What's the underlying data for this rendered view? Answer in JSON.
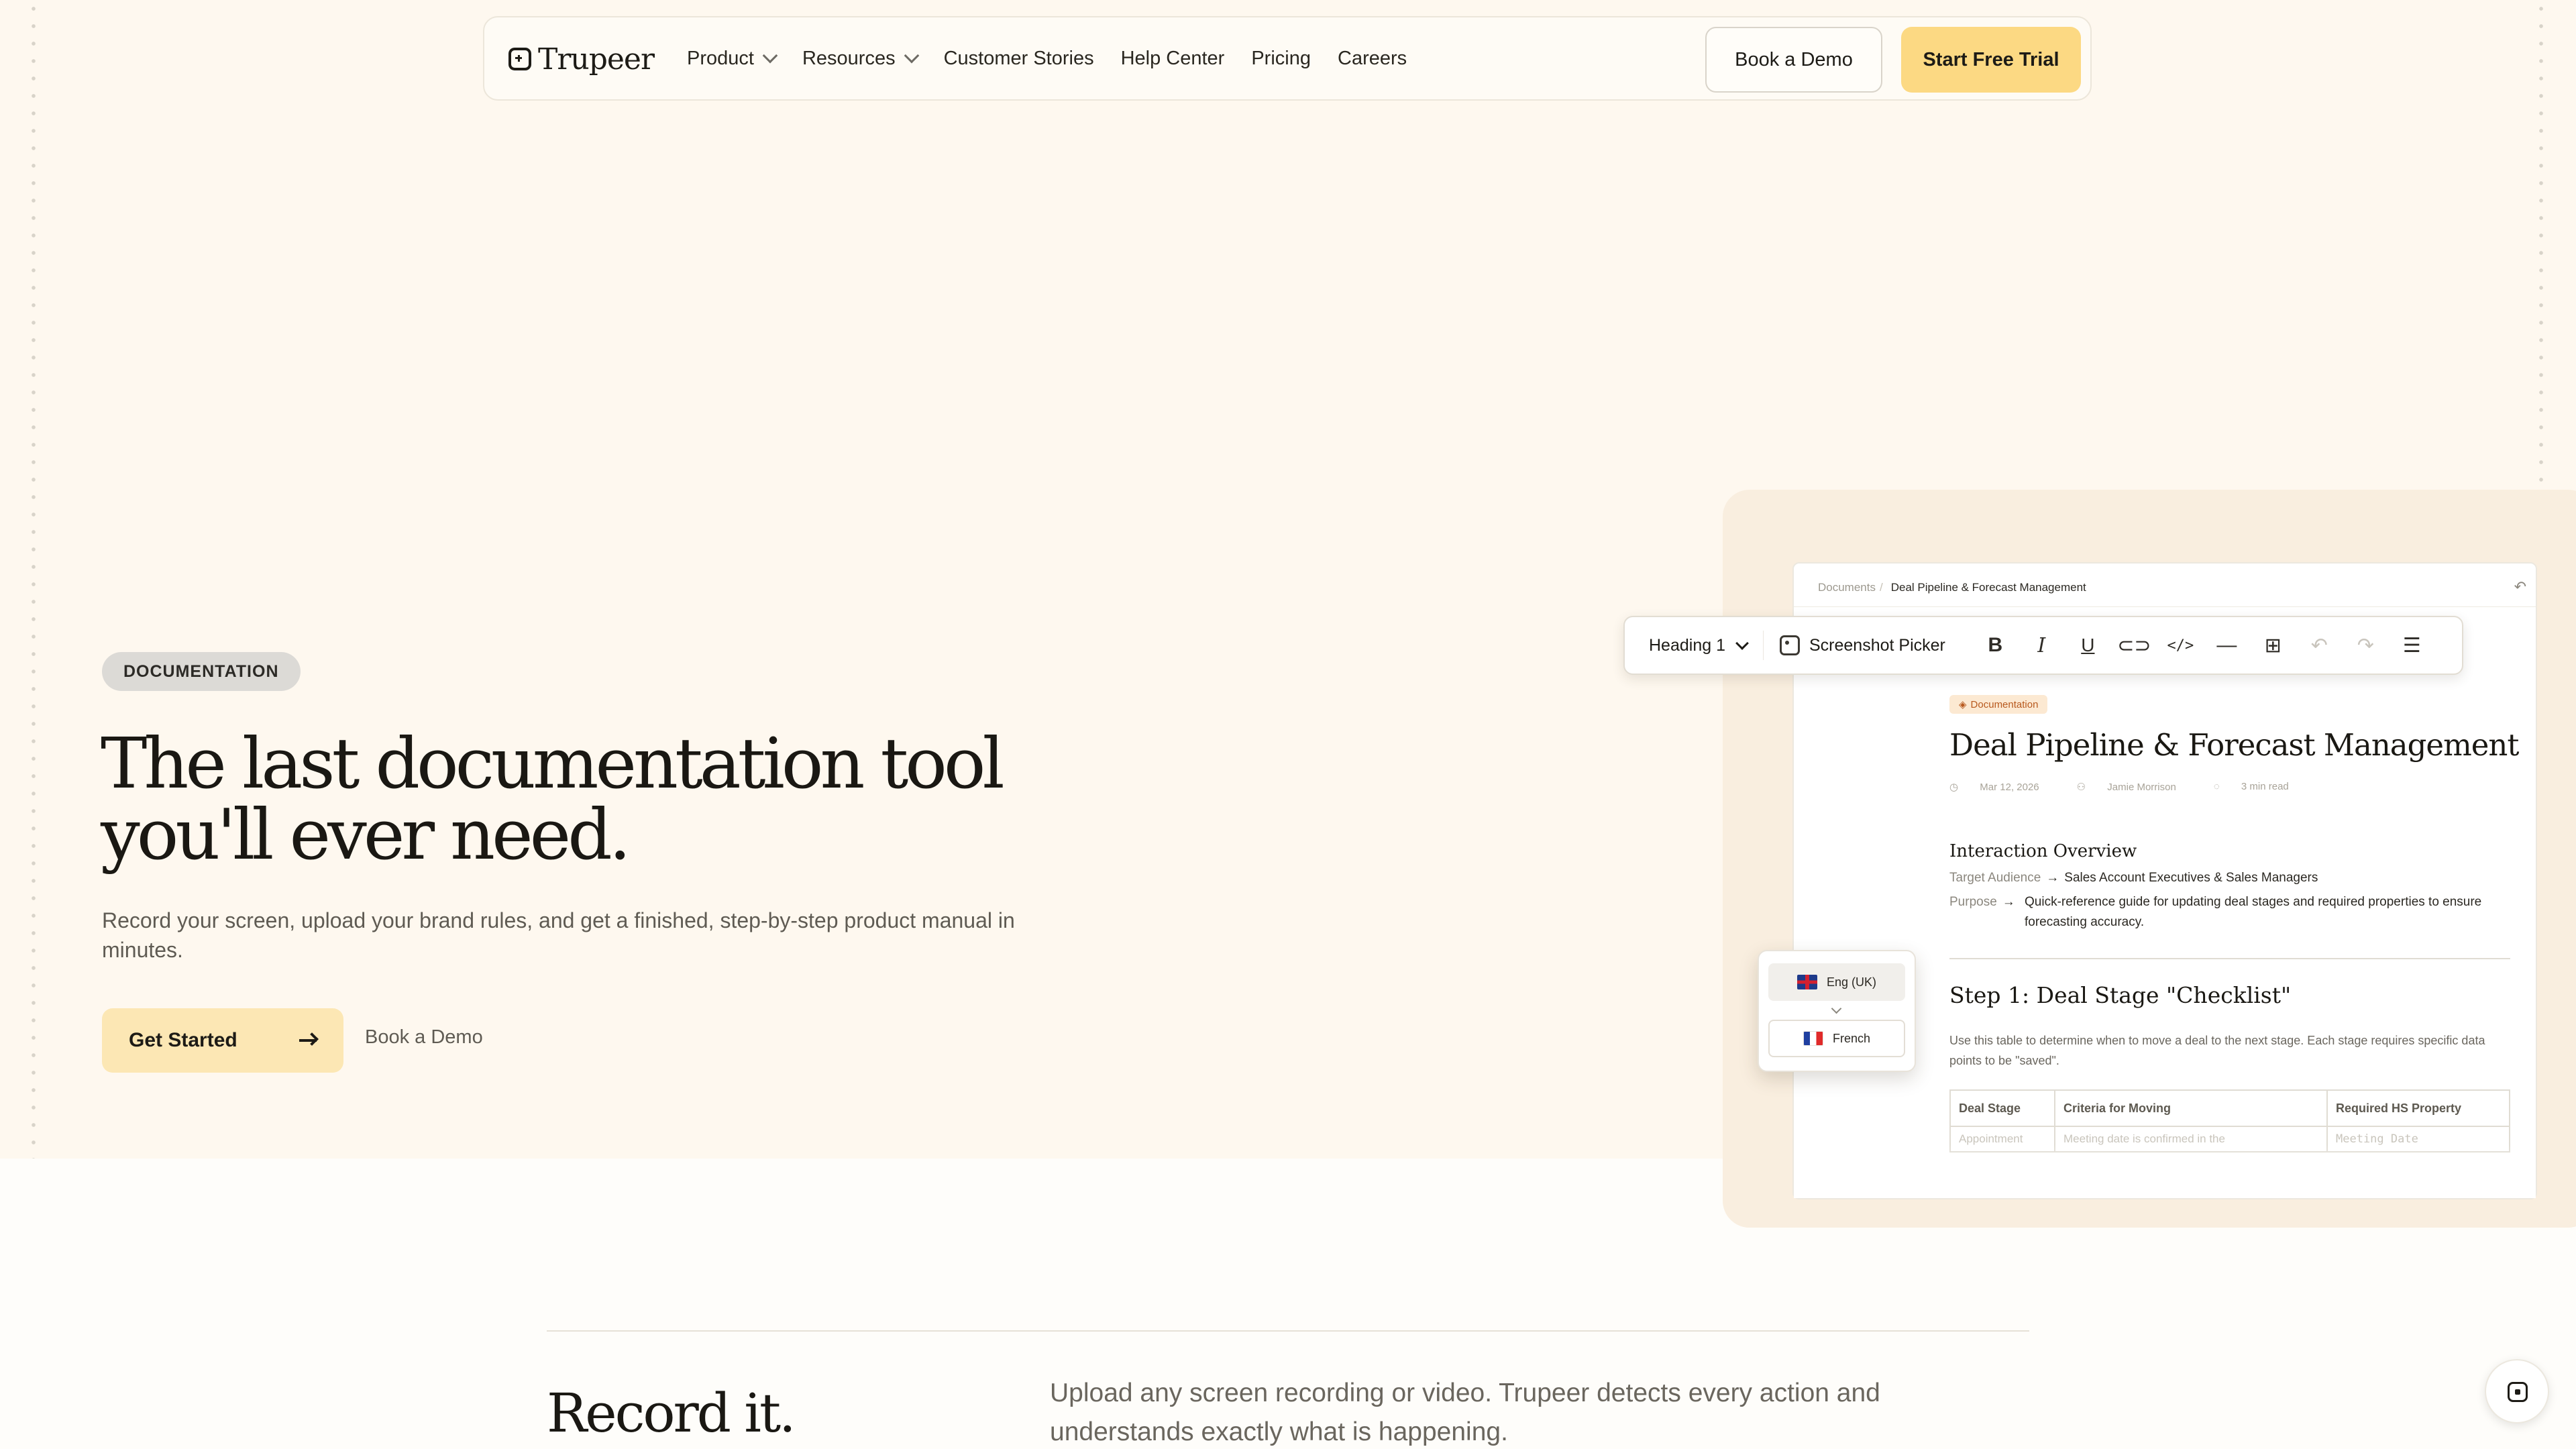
{
  "nav": {
    "logo_text": "Trupeer",
    "items": [
      {
        "label": "Product",
        "dropdown": true
      },
      {
        "label": "Resources",
        "dropdown": true
      },
      {
        "label": "Customer Stories",
        "dropdown": false
      },
      {
        "label": "Help Center",
        "dropdown": false
      },
      {
        "label": "Pricing",
        "dropdown": false
      },
      {
        "label": "Careers",
        "dropdown": false
      }
    ],
    "book_demo": "Book a Demo",
    "start_trial": "Start Free Trial"
  },
  "hero": {
    "badge": "DOCUMENTATION",
    "title": "The last documentation tool you'll ever need.",
    "subtitle": "Record your screen, upload your brand rules, and get a finished, step-by-step product manual in minutes.",
    "cta_primary": "Get Started",
    "cta_secondary": "Book a Demo"
  },
  "editor": {
    "breadcrumb_root": "Documents",
    "breadcrumb_current": "Deal Pipeline & Forecast Management",
    "toolbar": {
      "heading_select": "Heading 1",
      "screenshot_picker": "Screenshot Picker",
      "icons": [
        "bold-icon",
        "italic-icon",
        "underline-icon",
        "link-icon",
        "code-icon",
        "divider-icon",
        "image-picker-icon",
        "undo-icon",
        "redo-icon",
        "checklist-icon"
      ]
    },
    "doc_badge": "Documentation",
    "doc_title": "Deal Pipeline & Forecast Management",
    "meta": {
      "date": "Mar 12, 2026",
      "author": "Jamie Morrison",
      "read_time": "3 min read"
    },
    "overview_title": "Interaction Overview",
    "target_label": "Target Audience",
    "target_value": "Sales Account Executives & Sales Managers",
    "purpose_label": "Purpose",
    "purpose_value": "Quick-reference guide for updating deal stages and required properties to ensure forecasting accuracy.",
    "step_title": "Step 1: Deal Stage \"Checklist\"",
    "step_desc": "Use this table to determine when to move a deal to the next stage. Each stage requires specific data points to be \"saved\".",
    "table": {
      "headers": [
        "Deal Stage",
        "Criteria for Moving",
        "Required HS Property"
      ],
      "rows": [
        [
          "Appointment",
          "Meeting date is confirmed in the",
          "Meeting Date"
        ]
      ]
    }
  },
  "languages": {
    "current": "Eng (UK)",
    "option": "French"
  },
  "section": {
    "title": "Record it.",
    "body": "Upload any screen recording or video. Trupeer detects every action and understands exactly what is happening."
  },
  "colors": {
    "hero_bg": "#FEF8EF",
    "accent": "#FCD983",
    "badge_accent": "#B8591E"
  }
}
